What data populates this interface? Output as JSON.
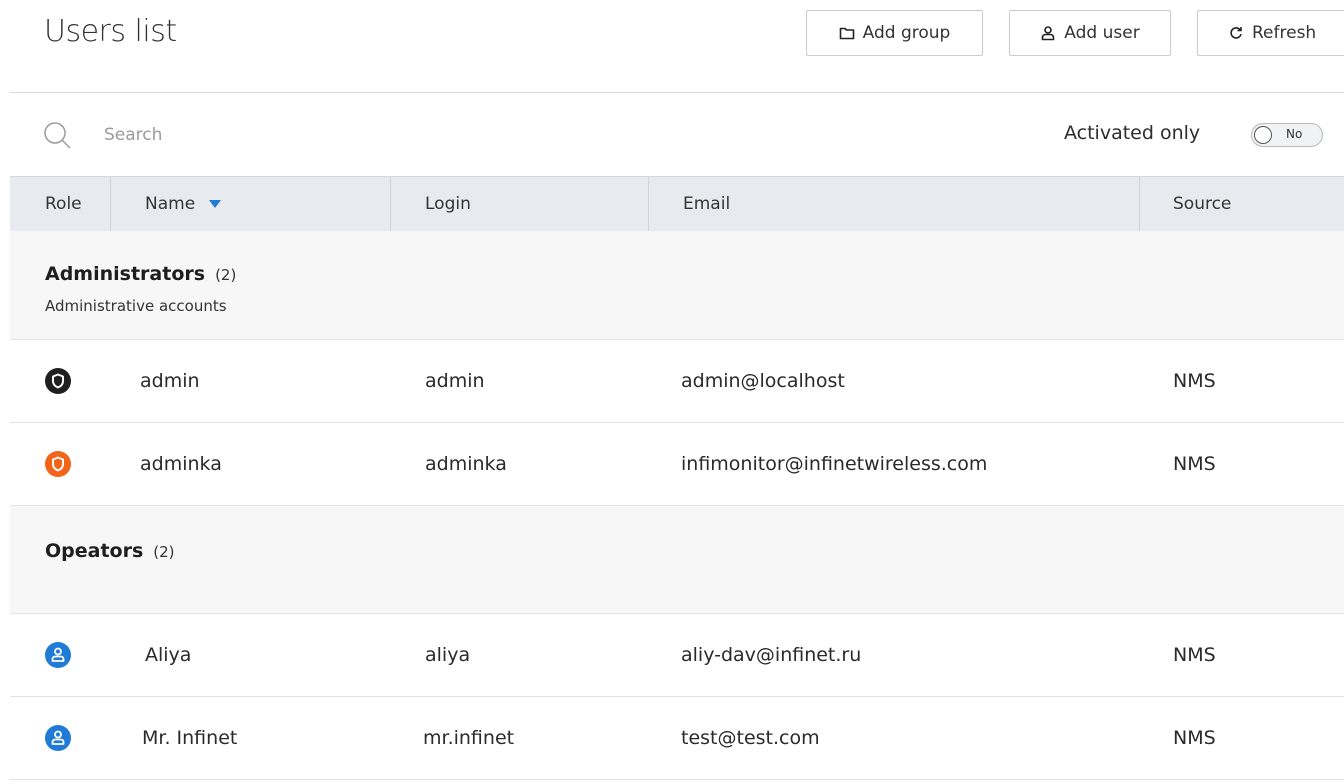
{
  "header": {
    "title": "Users list",
    "add_group_label": "Add group",
    "add_user_label": "Add user",
    "refresh_label": "Refresh"
  },
  "filter": {
    "search_placeholder": "Search",
    "activated_label": "Activated only",
    "toggle_value": "No"
  },
  "table": {
    "columns": [
      "Role",
      "Name",
      "Login",
      "Email",
      "Source"
    ],
    "sort_column": "Name",
    "groups": [
      {
        "name": "Administrators",
        "count": "(2)",
        "description": "Administrative accounts",
        "users": [
          {
            "role": "admin",
            "role_color": "#1f1f1f",
            "name": "admin",
            "login": "admin",
            "email": "admin@localhost",
            "source": "NMS"
          },
          {
            "role": "admin",
            "role_color": "#f26418",
            "name": "adminka",
            "login": "adminka",
            "email": "infimonitor@infinetwireless.com",
            "source": "NMS"
          }
        ]
      },
      {
        "name": "Opeators",
        "count": "(2)",
        "description": "",
        "users": [
          {
            "role": "operator",
            "role_color": "#1f7bd6",
            "name": "Aliya",
            "login": "aliya",
            "email": "aliy-dav@infinet.ru",
            "source": "NMS"
          },
          {
            "role": "operator",
            "role_color": "#1f7bd6",
            "name": "Mr. Infinet",
            "login": "mr.infinet",
            "email": "test@test.com",
            "source": "NMS"
          }
        ]
      }
    ]
  },
  "colors": {
    "accent": "#1f7bd6",
    "header_bg": "#e7eaee",
    "group_bg": "#f7f7f7"
  }
}
